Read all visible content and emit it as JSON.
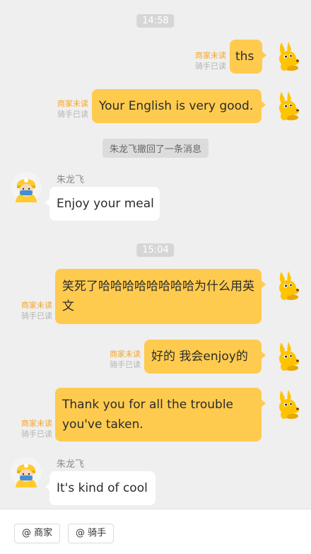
{
  "messages": [
    {
      "time": "14:58"
    },
    {
      "text": "ths",
      "merchant_status": "商家未读",
      "rider_status": "骑手已读"
    },
    {
      "text": "Your English is very good.",
      "merchant_status": "商家未读",
      "rider_status": "骑手已读"
    },
    {
      "recall_notice": "朱龙飞撤回了一条消息"
    },
    {
      "sender": "朱龙飞",
      "text": "Enjoy your meal"
    },
    {
      "time": "15:04"
    },
    {
      "text": "笑死了哈哈哈哈哈哈哈哈为什么用英文",
      "merchant_status": "商家未读",
      "rider_status": "骑手已读"
    },
    {
      "text": "好的 我会enjoy的",
      "merchant_status": "商家未读",
      "rider_status": "骑手已读"
    },
    {
      "text": "Thank you for all the trouble you've taken.",
      "merchant_status": "商家未读",
      "rider_status": "骑手已读"
    },
    {
      "sender": "朱龙飞",
      "text": "It's kind of cool"
    }
  ],
  "bottom_bar": {
    "mention_merchant": "@ 商家",
    "mention_rider": "@ 骑手"
  },
  "colors": {
    "outgoing_bubble": "#ffcb4f",
    "merchant_unread": "#f4a52b",
    "rider_read": "#b4b4b4",
    "background": "#efefef"
  }
}
